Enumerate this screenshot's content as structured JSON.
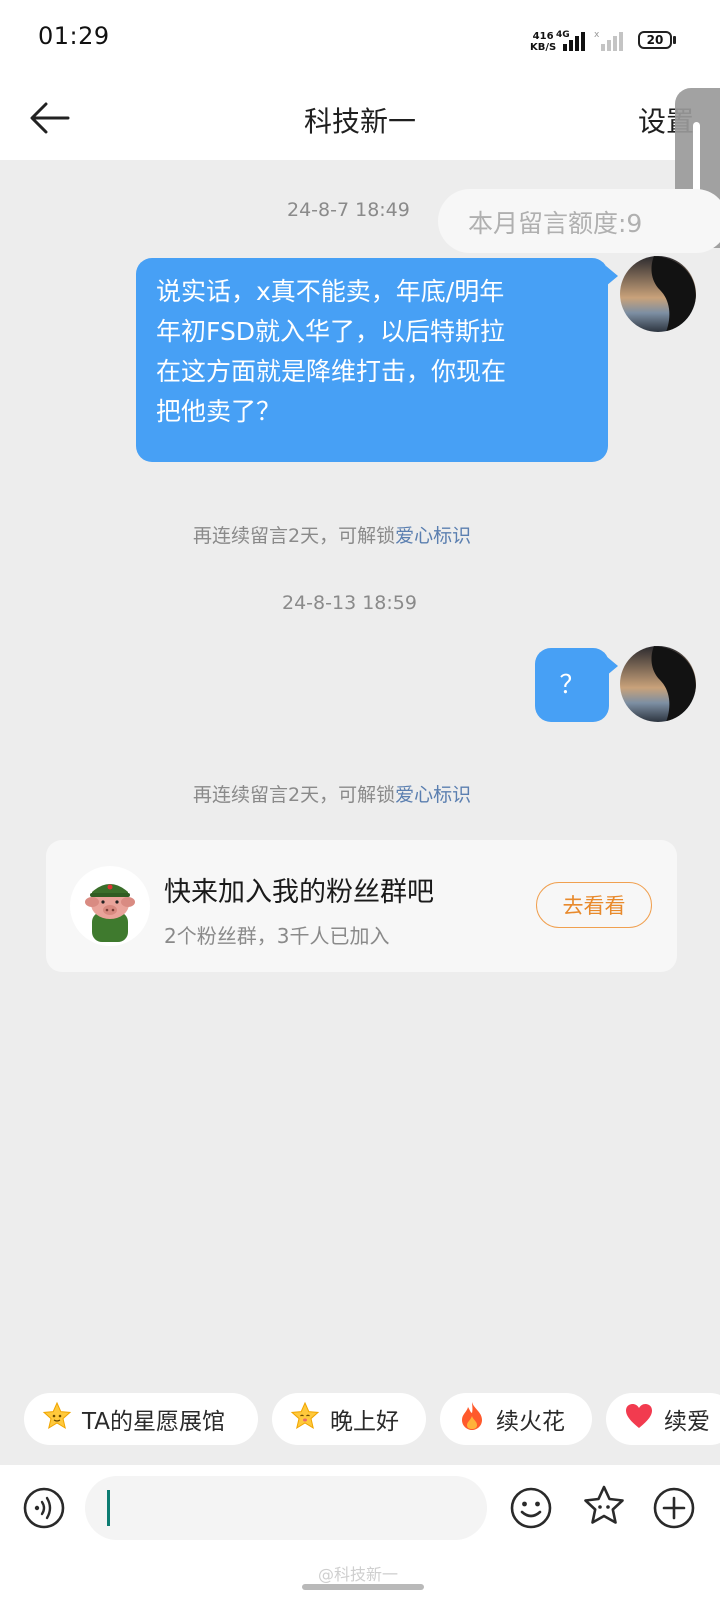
{
  "status_bar": {
    "time": "01:29",
    "net_speed_value": "416",
    "net_speed_unit": "KB/S",
    "network_type": "4G",
    "battery": "20"
  },
  "header": {
    "title": "科技新一",
    "settings_label": "设置"
  },
  "quota": {
    "text": "本月留言额度:9"
  },
  "messages": [
    {
      "timestamp": "24-8-7 18:49",
      "text_lines": [
        "说实话，x真不能卖，年底/明年",
        "年初FSD就入华了，以后特斯拉",
        "在这方面就是降维打击，你现在",
        "把他卖了？"
      ],
      "system_prefix": "再连续留言2天，可解锁",
      "system_link": "爱心标识"
    },
    {
      "timestamp": "24-8-13 18:59",
      "text": "？",
      "system_prefix": "再连续留言2天，可解锁",
      "system_link": "爱心标识"
    }
  ],
  "fan_group": {
    "title": "快来加入我的粉丝群吧",
    "subtitle": "2个粉丝群，3千人已加入",
    "button": "去看看"
  },
  "quick_actions": [
    {
      "icon": "star-face-icon",
      "label": "TA的星愿展馆"
    },
    {
      "icon": "star-face-icon",
      "label": "晚上好"
    },
    {
      "icon": "fire-icon",
      "label": "续火花"
    },
    {
      "icon": "heart-icon",
      "label": "续爱"
    }
  ],
  "watermark": "@科技新一",
  "colors": {
    "bubble": "#47a0f5",
    "link": "#5b7fb0",
    "accent_orange": "#e88a2c",
    "background": "#ededed"
  }
}
